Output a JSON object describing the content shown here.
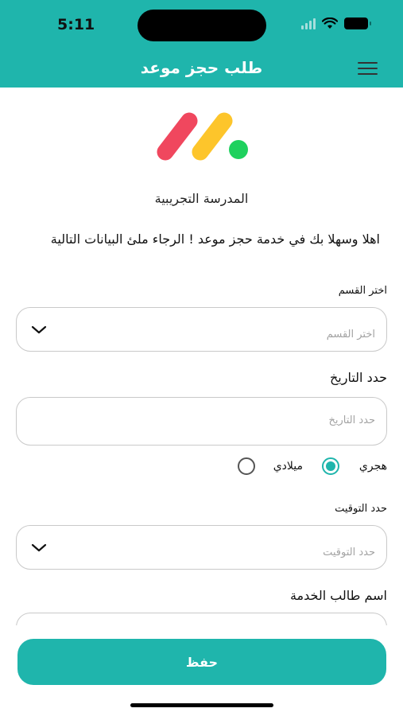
{
  "status_bar": {
    "time": "5:11"
  },
  "header": {
    "title": "طلب حجز موعد",
    "menu_icon": "hamburger-menu-icon"
  },
  "logo": {
    "icon": "brand-logo",
    "colors": [
      "#f0475e",
      "#fdc52b",
      "#1fd15e"
    ]
  },
  "school_name": "المدرسة التجريبية",
  "welcome_text": "اهلا وسهلا بك في خدمة حجز موعد ! الرجاء ملئ البيانات التالية",
  "department": {
    "label": "اختر القسم",
    "placeholder": "اختر القسم"
  },
  "date": {
    "label": "حدد التاريخ",
    "placeholder": "حدد التاريخ",
    "calendar_options": [
      {
        "label": "هجري",
        "selected": true
      },
      {
        "label": "ميلادي",
        "selected": false
      }
    ]
  },
  "time": {
    "label": "حدد التوقيت",
    "placeholder": "حدد التوقيت"
  },
  "applicant_name": {
    "label": "اسم طالب الخدمة"
  },
  "save_button": {
    "label": "حفظ"
  },
  "colors": {
    "accent": "#1fb5ac",
    "border": "#c9c9c9",
    "placeholder": "#a3a3a3"
  }
}
